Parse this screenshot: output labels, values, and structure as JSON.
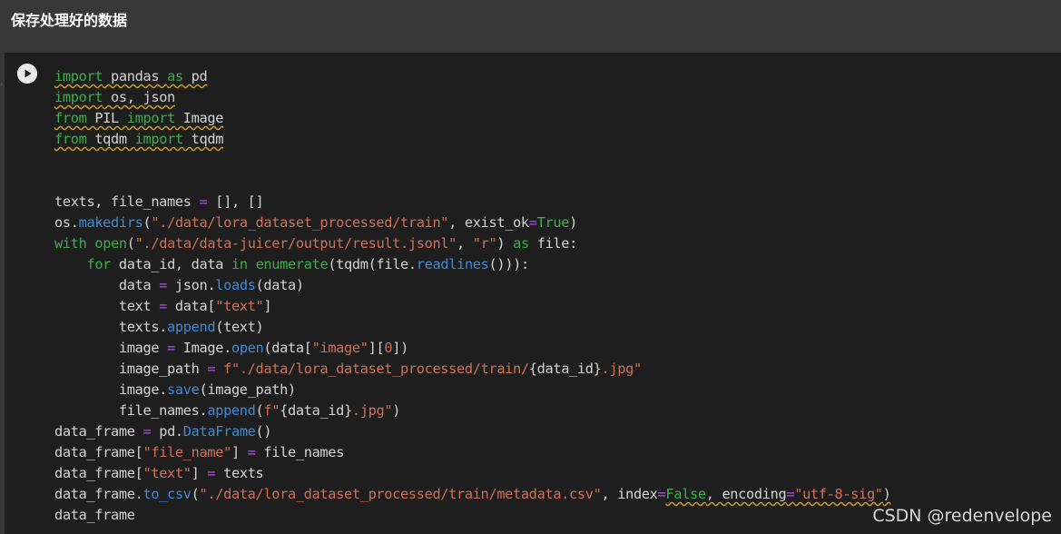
{
  "markdown": {
    "title": "保存处理好的数据"
  },
  "cell": {
    "run_icon": "play-icon"
  },
  "code_lines": [
    [
      [
        "kw sq",
        "import"
      ],
      [
        "sq",
        " pandas "
      ],
      [
        "kw sq",
        "as"
      ],
      [
        "sq",
        " pd"
      ]
    ],
    [
      [
        "kw sq",
        "import"
      ],
      [
        "sq",
        " os, json"
      ]
    ],
    [
      [
        "kw sq",
        "from"
      ],
      [
        "sq",
        " PIL "
      ],
      [
        "kw sq",
        "import"
      ],
      [
        "sq",
        " Image"
      ]
    ],
    [
      [
        "kw sq",
        "from"
      ],
      [
        "sq",
        " tqdm "
      ],
      [
        "kw sq",
        "import"
      ],
      [
        "sq",
        " tqdm"
      ]
    ],
    [],
    [],
    [
      [
        "",
        "texts, file_names "
      ],
      [
        "op",
        "="
      ],
      [
        "",
        " [], []"
      ]
    ],
    [
      [
        "",
        "os."
      ],
      [
        "fn",
        "makedirs"
      ],
      [
        "",
        "("
      ],
      [
        "st",
        "\"./data/lora_dataset_processed/train\""
      ],
      [
        "",
        ", exist_ok"
      ],
      [
        "op",
        "="
      ],
      [
        "cn",
        "True"
      ],
      [
        "",
        ")"
      ]
    ],
    [
      [
        "kw",
        "with"
      ],
      [
        "",
        " "
      ],
      [
        "bi",
        "open"
      ],
      [
        "",
        "("
      ],
      [
        "st",
        "\"./data/data-juicer/output/result.jsonl\""
      ],
      [
        "",
        ", "
      ],
      [
        "st",
        "\"r\""
      ],
      [
        "",
        ") "
      ],
      [
        "kw",
        "as"
      ],
      [
        "",
        " file:"
      ]
    ],
    [
      [
        "",
        "    "
      ],
      [
        "kw",
        "for"
      ],
      [
        "",
        " data_id, data "
      ],
      [
        "kw",
        "in"
      ],
      [
        "",
        " "
      ],
      [
        "bi",
        "enumerate"
      ],
      [
        "",
        "(tqdm(file."
      ],
      [
        "fn",
        "readlines"
      ],
      [
        "",
        "())):"
      ]
    ],
    [
      [
        "",
        "        data "
      ],
      [
        "op",
        "="
      ],
      [
        "",
        " json."
      ],
      [
        "fn",
        "loads"
      ],
      [
        "",
        "(data)"
      ]
    ],
    [
      [
        "",
        "        text "
      ],
      [
        "op",
        "="
      ],
      [
        "",
        " data["
      ],
      [
        "st",
        "\"text\""
      ],
      [
        "",
        "]"
      ]
    ],
    [
      [
        "",
        "        texts."
      ],
      [
        "fn",
        "append"
      ],
      [
        "",
        "(text)"
      ]
    ],
    [
      [
        "",
        "        image "
      ],
      [
        "op",
        "="
      ],
      [
        "",
        " Image."
      ],
      [
        "fn",
        "open"
      ],
      [
        "",
        "(data["
      ],
      [
        "st",
        "\"image\""
      ],
      [
        "",
        "]["
      ],
      [
        "st",
        "0"
      ],
      [
        "",
        "])"
      ]
    ],
    [
      [
        "",
        "        image_path "
      ],
      [
        "op",
        "="
      ],
      [
        "",
        " "
      ],
      [
        "st",
        "f\"./data/lora_dataset_processed/train/"
      ],
      [
        "",
        "{data_id}"
      ],
      [
        "st",
        ".jpg\""
      ]
    ],
    [
      [
        "",
        "        image."
      ],
      [
        "fn",
        "save"
      ],
      [
        "",
        "(image_path)"
      ]
    ],
    [
      [
        "",
        "        file_names."
      ],
      [
        "fn",
        "append"
      ],
      [
        "",
        "("
      ],
      [
        "st",
        "f\""
      ],
      [
        "",
        "{data_id}"
      ],
      [
        "st",
        ".jpg\""
      ],
      [
        "",
        ")"
      ]
    ],
    [
      [
        "",
        "data_frame "
      ],
      [
        "op",
        "="
      ],
      [
        "",
        " pd."
      ],
      [
        "fn",
        "DataFrame"
      ],
      [
        "",
        "()"
      ]
    ],
    [
      [
        "",
        "data_frame["
      ],
      [
        "st",
        "\"file_name\""
      ],
      [
        "",
        "] "
      ],
      [
        "op",
        "="
      ],
      [
        "",
        " file_names"
      ]
    ],
    [
      [
        "",
        "data_frame["
      ],
      [
        "st",
        "\"text\""
      ],
      [
        "",
        "] "
      ],
      [
        "op",
        "="
      ],
      [
        "",
        " texts"
      ]
    ],
    [
      [
        "",
        "data_frame."
      ],
      [
        "fn",
        "to_csv"
      ],
      [
        "",
        "("
      ],
      [
        "st",
        "\"./data/lora_dataset_processed/train/metadata.csv\""
      ],
      [
        "",
        ", index"
      ],
      [
        "op",
        "="
      ],
      [
        "cn sq",
        "False"
      ],
      [
        "sq",
        ", encoding"
      ],
      [
        "op sq",
        "="
      ],
      [
        "st sq",
        "\"utf-8-sig\""
      ],
      [
        "sq",
        ")"
      ]
    ],
    [
      [
        "",
        "data_frame"
      ]
    ]
  ],
  "watermark": "CSDN @redenvelope",
  "colors": {
    "background": "#383838",
    "cell_background": "#1e1e1e",
    "keyword": "#3cae4a",
    "function": "#3e8ad6",
    "string": "#ce7056",
    "operator": "#b04ee8"
  }
}
